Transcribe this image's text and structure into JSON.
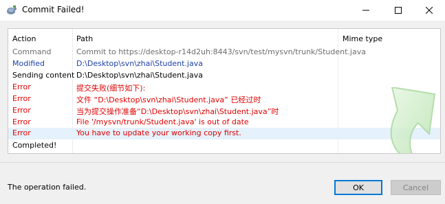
{
  "window": {
    "title": "Commit Failed!"
  },
  "table": {
    "columns": [
      "Action",
      "Path",
      "Mime type"
    ],
    "rows": [
      {
        "action": "Command",
        "path": "Commit to https://desktop-r14d2uh:8443/svn/test/mysvn/trunk/Student.java"
      },
      {
        "action": "Modified",
        "path": "D:\\Desktop\\svn\\zhai\\Student.java"
      },
      {
        "action": "Sending content",
        "path": "D:\\Desktop\\svn\\zhai\\Student.java"
      },
      {
        "action": "Error",
        "path": "提交失败(细节如下):"
      },
      {
        "action": "Error",
        "path": "文件 “D:\\Desktop\\svn\\zhai\\Student.java” 已经过时"
      },
      {
        "action": "Error",
        "path": "当为提交操作准备“D:\\Desktop\\svn\\zhai\\Student.java”时"
      },
      {
        "action": "Error",
        "path": "File '/mysvn/trunk/Student.java' is out of date"
      },
      {
        "action": "Error",
        "path": "You have to update your working copy first."
      },
      {
        "action": "Completed!",
        "path": ""
      }
    ]
  },
  "status": {
    "text": "The operation failed."
  },
  "buttons": {
    "ok": "OK",
    "cancel": "Cancel"
  },
  "colors": {
    "command": "#6d6d6d",
    "modified": "#1c3fa8",
    "normal": "#000000",
    "error": "#e00000",
    "accent": "#0078d7"
  }
}
